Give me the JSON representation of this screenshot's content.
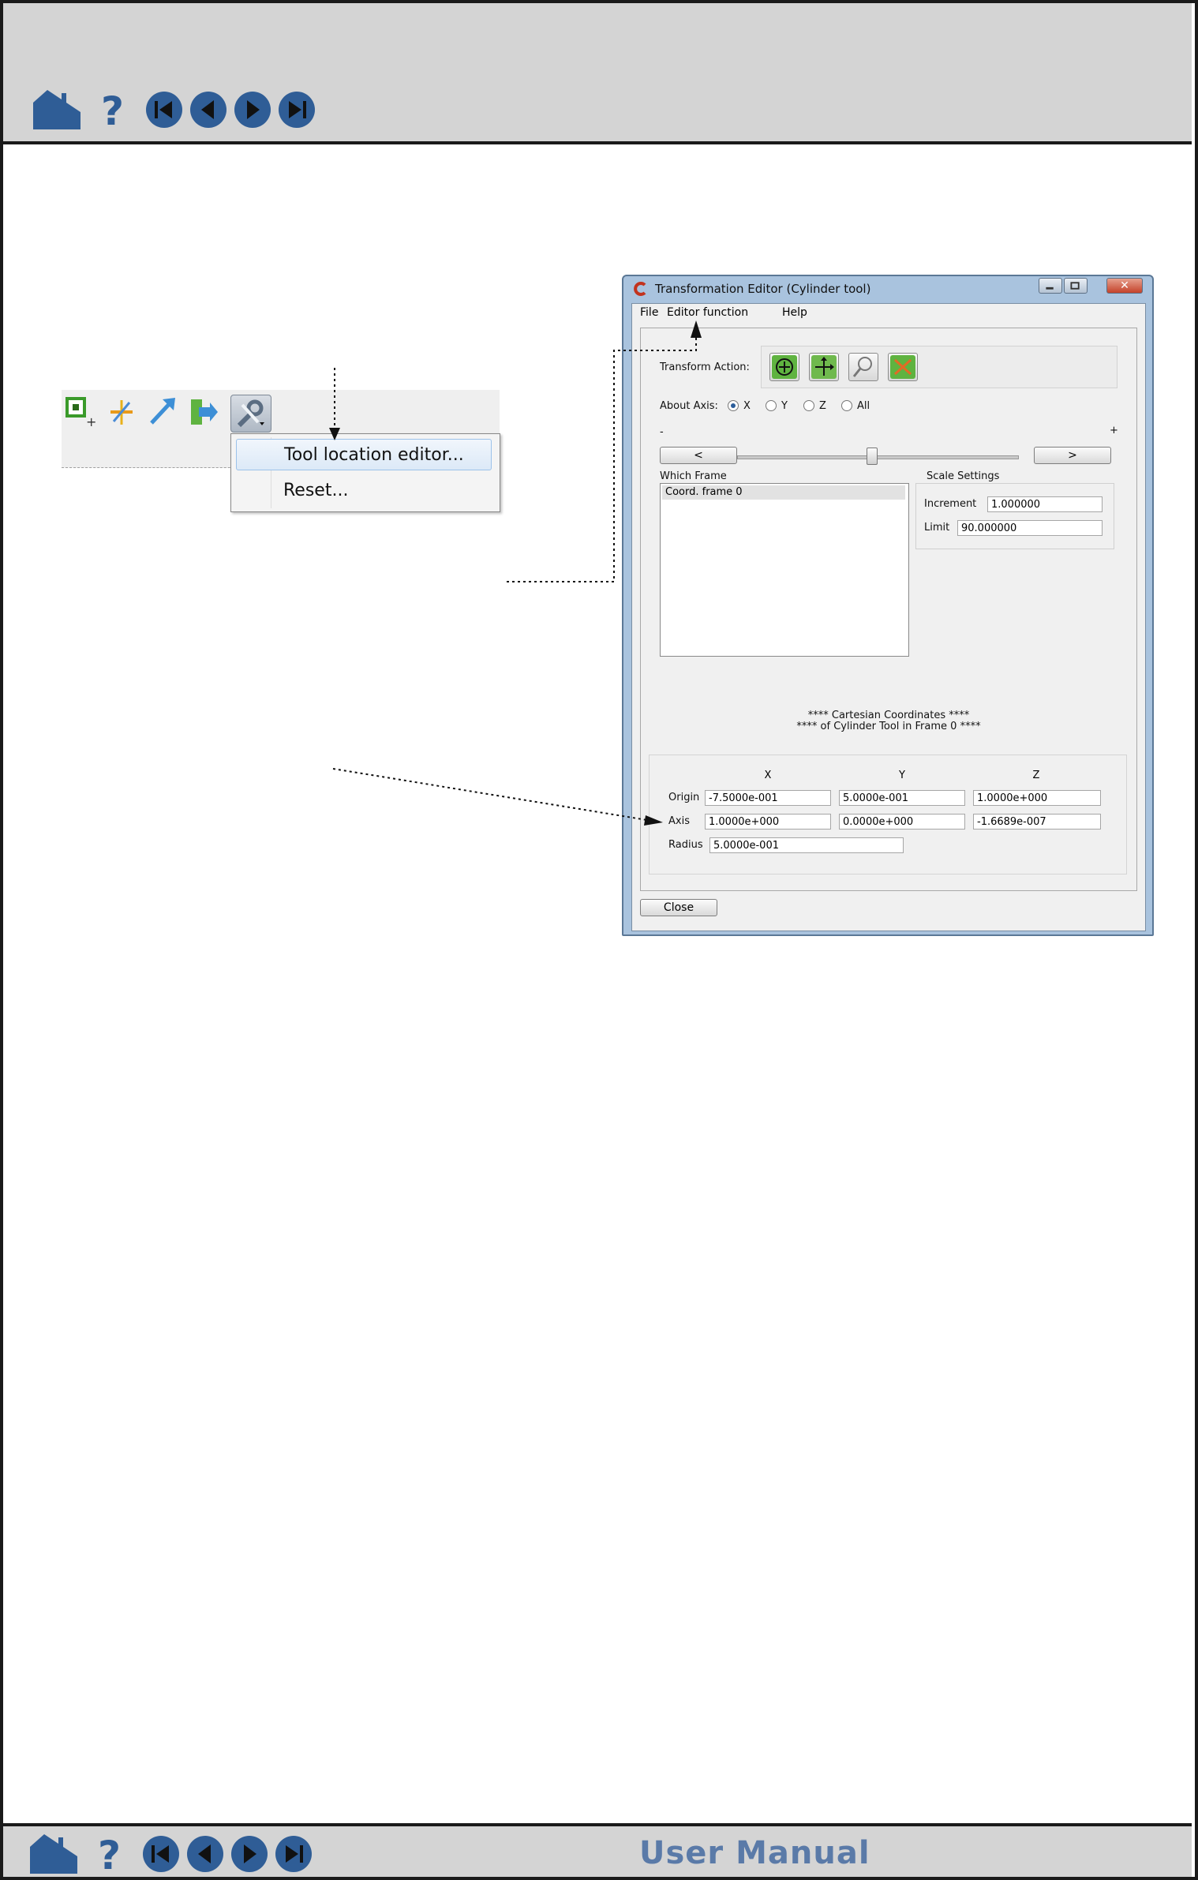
{
  "footer": {
    "title": "User Manual"
  },
  "toolbar": {
    "icons": [
      "new-part-icon",
      "axis-tool-icon",
      "arrow-tool-icon",
      "exit-tool-icon",
      "tool-settings-icon"
    ]
  },
  "context_menu": {
    "items": [
      {
        "label": "Tool location editor..."
      },
      {
        "label": "Reset..."
      }
    ]
  },
  "editor": {
    "title": "Transformation Editor (Cylinder tool)",
    "menu": [
      "File",
      "Editor function",
      "Help"
    ],
    "transform_action_label": "Transform Action:",
    "about_axis_label": "About Axis:",
    "axis_options": [
      "X",
      "Y",
      "Z",
      "All"
    ],
    "axis_selected": "X",
    "minus_label": "-",
    "plus_label": "+",
    "prev_button": "<",
    "next_button": ">",
    "which_frame_label": "Which Frame",
    "frames": [
      "Coord. frame 0"
    ],
    "scale_settings_label": "Scale Settings",
    "increment_label": "Increment",
    "increment_value": "1.000000",
    "limit_label": "Limit",
    "limit_value": "90.000000",
    "coords_heading_1": "**** Cartesian Coordinates ****",
    "coords_heading_2": "**** of Cylinder Tool in Frame 0 ****",
    "col_x": "X",
    "col_y": "Y",
    "col_z": "Z",
    "origin_label": "Origin",
    "origin": [
      "-7.5000e-001",
      "5.0000e-001",
      "1.0000e+000"
    ],
    "axis_label": "Axis",
    "axis": [
      "1.0000e+000",
      "0.0000e+000",
      "-1.6689e-007"
    ],
    "radius_label": "Radius",
    "radius": "5.0000e-001",
    "close_button": "Close"
  }
}
